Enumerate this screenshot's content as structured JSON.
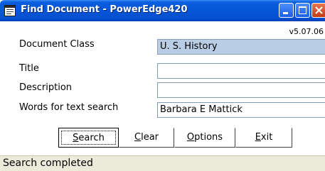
{
  "window": {
    "title": "Find Document - PowerEdge420",
    "version": "v5.07.06"
  },
  "form": {
    "document_class": {
      "label": "Document Class",
      "value": "U. S. History"
    },
    "title": {
      "label": "Title",
      "value": ""
    },
    "description": {
      "label": "Description",
      "value": ""
    },
    "words": {
      "label": "Words for text search",
      "value": "Barbara E Mattick"
    }
  },
  "buttons": {
    "search": {
      "accel": "S",
      "rest": "earch"
    },
    "clear": {
      "accel": "C",
      "rest": "lear"
    },
    "options": {
      "accel": "O",
      "rest": "ptions"
    },
    "exit": {
      "accel": "E",
      "rest": "xit"
    }
  },
  "status": {
    "text": "Search completed"
  },
  "colors": {
    "titlebar": "#0555d8",
    "readonly_field": "#b9cde4",
    "statusbar": "#ecead8"
  },
  "icons": {
    "window_icon": "document-window-icon",
    "minimize": "minimize-icon",
    "maximize": "maximize-icon",
    "close": "close-icon"
  }
}
